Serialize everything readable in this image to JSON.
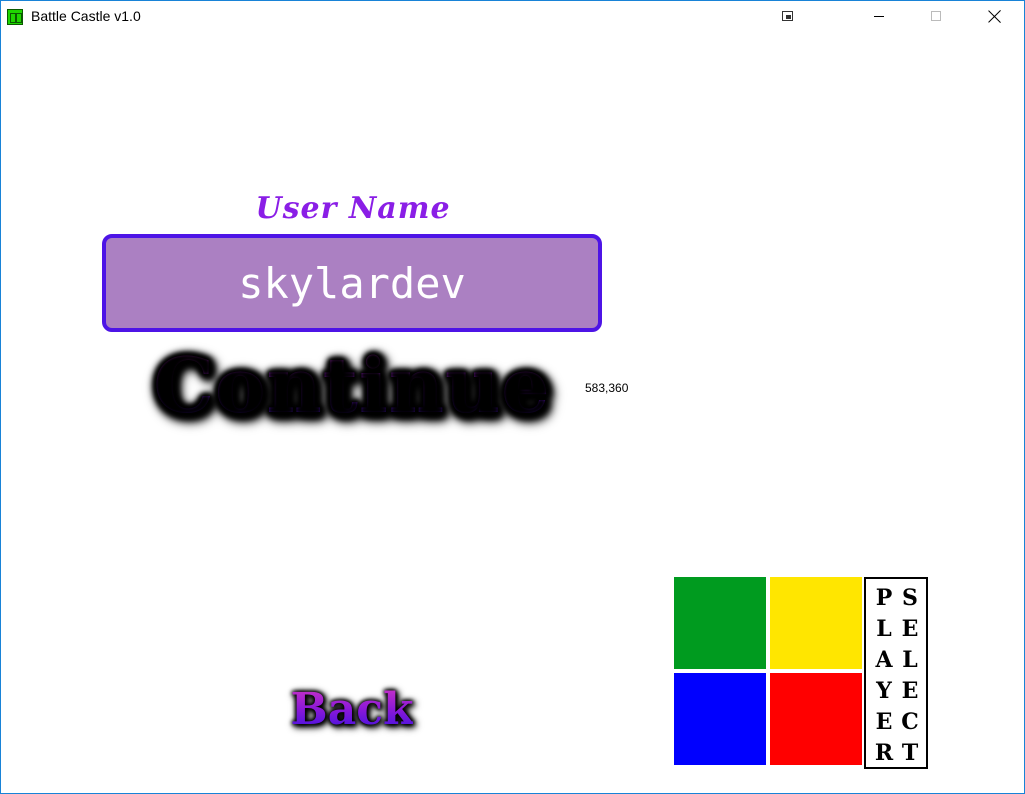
{
  "window": {
    "title": "Battle Castle v1.0"
  },
  "login": {
    "label": "User Name",
    "username_value": "skylardev",
    "continue_label": "Continue",
    "back_label": "Back"
  },
  "debug": {
    "coordinates": "583,360"
  },
  "color_picker": {
    "colors": [
      "#009b1f",
      "#ffe600",
      "#0000ff",
      "#ff0000"
    ]
  },
  "player_select": {
    "left_column": [
      "P",
      "L",
      "A",
      "Y",
      "E",
      "R"
    ],
    "right_column": [
      "S",
      "E",
      "L",
      "E",
      "C",
      "T"
    ]
  }
}
